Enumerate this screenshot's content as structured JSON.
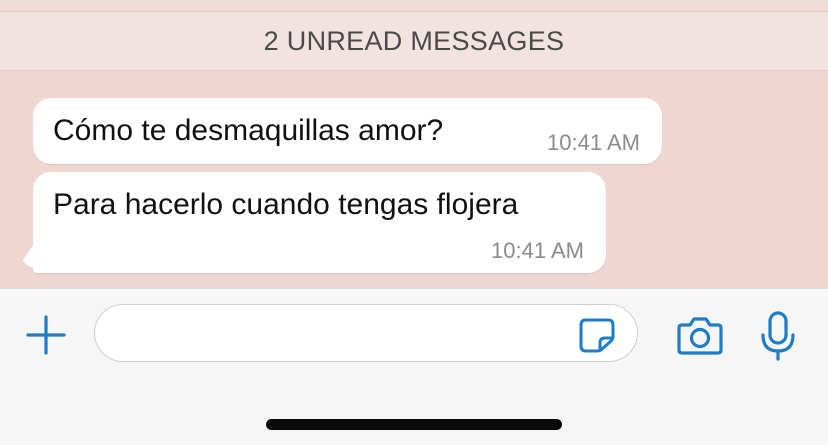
{
  "banner": {
    "unread_label": "2 UNREAD MESSAGES"
  },
  "messages": [
    {
      "text": "Cómo te desmaquillas amor?",
      "time": "10:41 AM",
      "direction": "incoming"
    },
    {
      "text": "Para hacerlo cuando tengas flojera",
      "time": "10:41 AM",
      "direction": "incoming"
    }
  ],
  "input_bar": {
    "message_value": "",
    "message_placeholder": "",
    "icons": {
      "attach": "plus-icon",
      "sticker": "sticker-icon",
      "camera": "camera-icon",
      "microphone": "microphone-icon"
    }
  },
  "colors": {
    "chat_background": "#efd6d0",
    "banner_background": "#f3e3e0",
    "bubble_incoming": "#ffffff",
    "accent_blue": "#1e7cc9",
    "timestamp_gray": "#8b8b8b"
  }
}
